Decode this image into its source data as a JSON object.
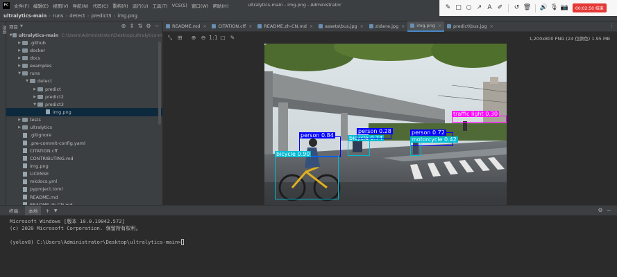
{
  "menubar": {
    "logo": "PC",
    "items": [
      "文件(F)",
      "编辑(E)",
      "视图(V)",
      "导航(N)",
      "代码(C)",
      "重构(R)",
      "运行(U)",
      "工具(T)",
      "VCS(S)",
      "窗口(W)",
      "帮助(H)"
    ],
    "window_title": "ultralytics-main - img.png - Administrator"
  },
  "recorder": {
    "icons": [
      "pencil-icon",
      "square-icon",
      "circle-icon",
      "arrow-icon",
      "text-icon",
      "highlighter-icon",
      "undo-icon",
      "trash-icon",
      "speaker-icon",
      "mic-icon",
      "camera-icon"
    ],
    "timer": "00:02:50 结束"
  },
  "breadcrumb": [
    "ultralytics-main",
    "runs",
    "detect",
    "predict3",
    "img.png"
  ],
  "project_panel": {
    "title": "项目",
    "sidebar_label": "项目"
  },
  "tree": [
    {
      "indent": 0,
      "arrow": "▼",
      "type": "folder",
      "label": "ultralytics-main",
      "note": "C:\\Users\\Administrator\\Desktop\\ultralytics-m"
    },
    {
      "indent": 1,
      "arrow": "▶",
      "type": "folder",
      "label": ".github"
    },
    {
      "indent": 1,
      "arrow": "▶",
      "type": "folder",
      "label": "docker"
    },
    {
      "indent": 1,
      "arrow": "▶",
      "type": "folder",
      "label": "docs"
    },
    {
      "indent": 1,
      "arrow": "▶",
      "type": "folder",
      "label": "examples"
    },
    {
      "indent": 1,
      "arrow": "▼",
      "type": "folder",
      "label": "runs"
    },
    {
      "indent": 2,
      "arrow": "▼",
      "type": "folder",
      "label": "detect"
    },
    {
      "indent": 3,
      "arrow": "▶",
      "type": "folder",
      "label": "predict"
    },
    {
      "indent": 3,
      "arrow": "▶",
      "type": "folder",
      "label": "predict2"
    },
    {
      "indent": 3,
      "arrow": "▼",
      "type": "folder",
      "label": "predict3"
    },
    {
      "indent": 4,
      "arrow": "",
      "type": "file",
      "label": "img.png"
    },
    {
      "indent": 1,
      "arrow": "▶",
      "type": "folder",
      "label": "tests"
    },
    {
      "indent": 1,
      "arrow": "▶",
      "type": "folder",
      "label": "ultralytics"
    },
    {
      "indent": 1,
      "arrow": "",
      "type": "file",
      "label": ".gitignore"
    },
    {
      "indent": 1,
      "arrow": "",
      "type": "file",
      "label": ".pre-commit-config.yaml"
    },
    {
      "indent": 1,
      "arrow": "",
      "type": "file",
      "label": "CITATION.cff"
    },
    {
      "indent": 1,
      "arrow": "",
      "type": "file",
      "label": "CONTRIBUTING.md"
    },
    {
      "indent": 1,
      "arrow": "",
      "type": "file",
      "label": "img.png"
    },
    {
      "indent": 1,
      "arrow": "",
      "type": "file",
      "label": "LICENSE"
    },
    {
      "indent": 1,
      "arrow": "",
      "type": "file",
      "label": "mkdocs.yml"
    },
    {
      "indent": 1,
      "arrow": "",
      "type": "file",
      "label": "pyproject.toml"
    },
    {
      "indent": 1,
      "arrow": "",
      "type": "file",
      "label": "README.md"
    },
    {
      "indent": 1,
      "arrow": "",
      "type": "file",
      "label": "README.zh-CN.md"
    }
  ],
  "tabs": [
    {
      "label": "README.md",
      "active": false
    },
    {
      "label": "CITATION.cff",
      "active": false
    },
    {
      "label": "README.zh-CN.md",
      "active": false
    },
    {
      "label": "assets\\bus.jpg",
      "active": false
    },
    {
      "label": "zidane.jpg",
      "active": false
    },
    {
      "label": "img.png",
      "active": true
    },
    {
      "label": "predict\\bus.jpg",
      "active": false
    }
  ],
  "image_info": "1,200x800 PNG (24 位颜色) 1.95 MB",
  "detections": [
    {
      "label": "traffic light 0.30",
      "color": "#ff00ff"
    },
    {
      "label": "person 0.84",
      "color": "#0000ff"
    },
    {
      "label": "bicycle 0.74",
      "color": "#00bcd4"
    },
    {
      "label": "person 0.28",
      "color": "#0000ff"
    },
    {
      "label": "person 0.72",
      "color": "#0000ff"
    },
    {
      "label": "motorcycle 0.42",
      "color": "#00bcd4"
    },
    {
      "label": "bicycle 0.90",
      "color": "#00bcd4"
    }
  ],
  "terminal": {
    "tab_title": "终端:",
    "tab_active": "本地",
    "lines": [
      "Microsoft Windows [版本 10.0.19042.572]",
      "(c) 2020 Microsoft Corporation. 保留所有权利。",
      "",
      "(yolov8) C:\\Users\\Administrator\\Desktop\\ultralytics-main>"
    ]
  }
}
